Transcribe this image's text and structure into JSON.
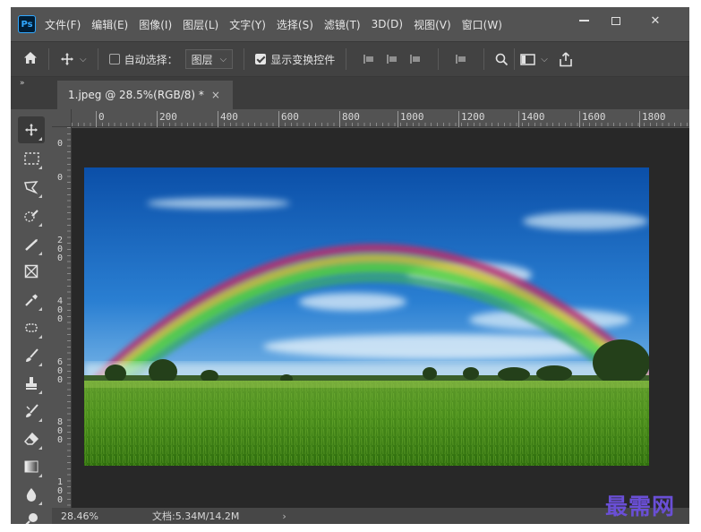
{
  "app": {
    "logo_text": "Ps",
    "menu": [
      "文件(F)",
      "编辑(E)",
      "图像(I)",
      "图层(L)",
      "文字(Y)",
      "选择(S)",
      "滤镜(T)",
      "3D(D)",
      "视图(V)",
      "窗口(W)"
    ]
  },
  "window_controls": {
    "close": "✕"
  },
  "options_bar": {
    "auto_select_label": "自动选择：",
    "auto_select_checked": false,
    "layer_select_value": "图层",
    "show_transform_label": "显示变换控件",
    "show_transform_checked": true
  },
  "tabs": [
    {
      "label": "1.jpeg @ 28.5%(RGB/8) *",
      "close": "×"
    }
  ],
  "rulers": {
    "top_labels": [
      "0",
      "200",
      "400",
      "600",
      "800",
      "1000",
      "1200",
      "1400",
      "1600",
      "1800"
    ],
    "left_labels": [
      "0",
      "0",
      "2\n0\n0",
      "4\n0\n0",
      "6\n0\n0",
      "8\n0\n0",
      "1\n0\n0"
    ]
  },
  "status": {
    "zoom": "28.46%",
    "doc_size": "文档:5.34M/14.2M",
    "chevron": "›"
  },
  "watermark": "最需网",
  "colors": {
    "ps_blue": "#31a8ff",
    "panel": "#535353",
    "canvas_bg": "#282828",
    "watermark": "#6a4fd6"
  },
  "icons": {
    "home": "home-icon",
    "move": "move-icon",
    "search": "search-icon",
    "share": "share-icon"
  }
}
